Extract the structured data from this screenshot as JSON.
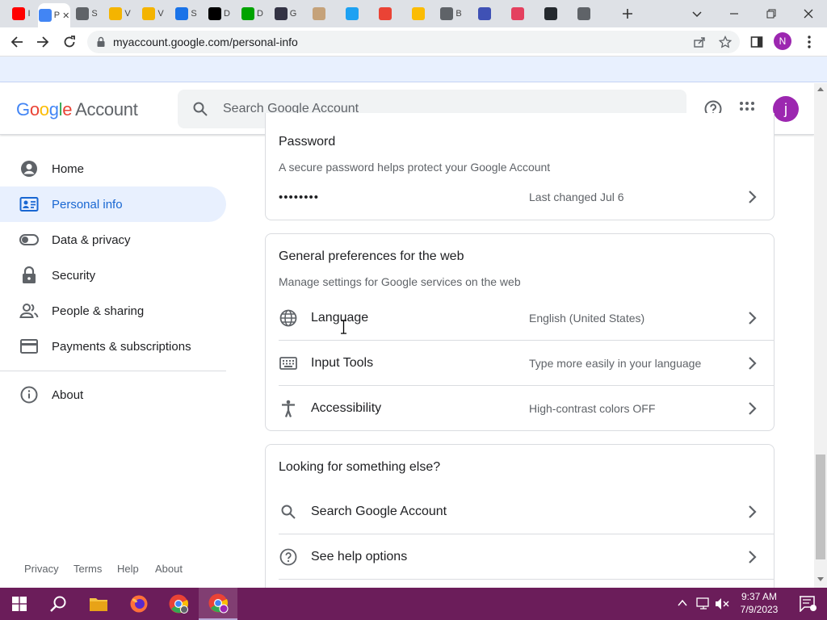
{
  "browser": {
    "tabs": [
      {
        "label": "I",
        "color": "#ff0000"
      },
      {
        "label": "P",
        "active": true,
        "color": "#4285f4"
      },
      {
        "label": "S",
        "color": "#5f6368"
      },
      {
        "label": "V",
        "color": "#f4b400"
      },
      {
        "label": "V",
        "color": "#f4b400"
      },
      {
        "label": "S",
        "color": "#1a73e8"
      },
      {
        "label": "D",
        "color": "#000000"
      },
      {
        "label": "D",
        "color": "#00a300"
      },
      {
        "label": "G",
        "color": "#334"
      },
      {
        "label": "",
        "color": "#c5a27a"
      },
      {
        "label": "",
        "color": "#1da1f2"
      },
      {
        "label": "",
        "color": "#ea4335"
      },
      {
        "label": "",
        "color": "#fbbc04"
      },
      {
        "label": "B",
        "color": "#5f6368"
      },
      {
        "label": "",
        "color": "#3f51b5"
      },
      {
        "label": "",
        "color": "#e4405f"
      },
      {
        "label": "",
        "color": "#24292e"
      },
      {
        "label": "",
        "color": "#5f6368"
      }
    ],
    "url": "myaccount.google.com/personal-info",
    "profile_initial": "N"
  },
  "header": {
    "logo_google": "Google",
    "logo_account": "Account",
    "search_placeholder": "Search Google Account",
    "avatar_initial": "j"
  },
  "sidebar": {
    "items": [
      {
        "label": "Home",
        "icon": "account-circle-icon"
      },
      {
        "label": "Personal info",
        "icon": "id-card-icon",
        "active": true
      },
      {
        "label": "Data & privacy",
        "icon": "toggle-icon"
      },
      {
        "label": "Security",
        "icon": "lock-icon"
      },
      {
        "label": "People & sharing",
        "icon": "people-icon"
      },
      {
        "label": "Payments & subscriptions",
        "icon": "credit-card-icon"
      },
      {
        "label": "About",
        "icon": "info-icon"
      }
    ],
    "footer": [
      "Privacy",
      "Terms",
      "Help",
      "About"
    ]
  },
  "password_card": {
    "title": "Password",
    "subtitle": "A secure password helps protect your Google Account",
    "value": "••••••••",
    "status": "Last changed Jul 6"
  },
  "preferences_card": {
    "title": "General preferences for the web",
    "subtitle": "Manage settings for Google services on the web",
    "rows": [
      {
        "label": "Language",
        "value": "English (United States)",
        "icon": "globe-icon"
      },
      {
        "label": "Input Tools",
        "value": "Type more easily in your language",
        "icon": "keyboard-icon"
      },
      {
        "label": "Accessibility",
        "value": "High-contrast colors OFF",
        "icon": "accessibility-icon"
      }
    ]
  },
  "else_card": {
    "title": "Looking for something else?",
    "rows": [
      {
        "label": "Search Google Account",
        "icon": "search-icon"
      },
      {
        "label": "See help options",
        "icon": "help-icon"
      }
    ]
  },
  "taskbar": {
    "time": "9:37 AM",
    "date": "7/9/2023"
  },
  "colors": {
    "accent": "#1a73e8",
    "active_bg": "#e8f0fe",
    "taskbar": "#6b1d5a"
  }
}
